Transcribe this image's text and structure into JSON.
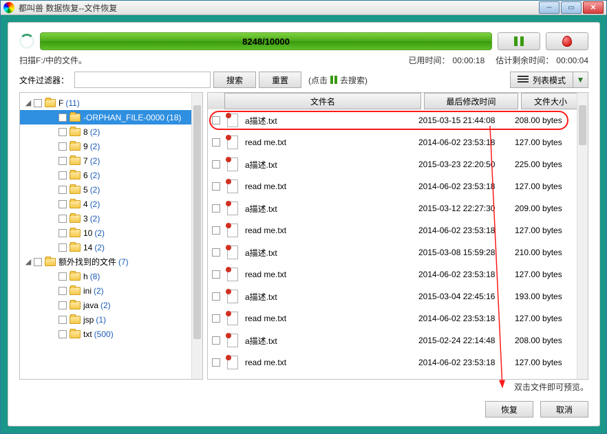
{
  "window": {
    "title": "都叫兽 数据恢复--文件恢复"
  },
  "progress": {
    "text": "8248/10000"
  },
  "status": {
    "scanning": "扫描F:/中的文件。",
    "elapsed_label": "已用时间：",
    "elapsed_value": "00:00:18",
    "remaining_label": "估计剩余时间：",
    "remaining_value": "00:00:04"
  },
  "filter": {
    "label": "文件过滤器：",
    "placeholder": "",
    "search_btn": "搜索",
    "reset_btn": "重置",
    "hint_prefix": "(点击",
    "hint_suffix": "去搜索)",
    "viewmode": "列表模式"
  },
  "list_headers": {
    "name": "文件名",
    "date": "最后修改时间",
    "size": "文件大小"
  },
  "tree": [
    {
      "indent": 0,
      "twisty": "◢",
      "label": "F",
      "count": "(11)",
      "selected": false
    },
    {
      "indent": 1,
      "twisty": "",
      "label": "-ORPHAN_FILE-0000",
      "count": "(18)",
      "selected": true
    },
    {
      "indent": 1,
      "twisty": "",
      "label": "8",
      "count": "(2)"
    },
    {
      "indent": 1,
      "twisty": "",
      "label": "9",
      "count": "(2)"
    },
    {
      "indent": 1,
      "twisty": "",
      "label": "7",
      "count": "(2)"
    },
    {
      "indent": 1,
      "twisty": "",
      "label": "6",
      "count": "(2)"
    },
    {
      "indent": 1,
      "twisty": "",
      "label": "5",
      "count": "(2)"
    },
    {
      "indent": 1,
      "twisty": "",
      "label": "4",
      "count": "(2)"
    },
    {
      "indent": 1,
      "twisty": "",
      "label": "3",
      "count": "(2)"
    },
    {
      "indent": 1,
      "twisty": "",
      "label": "10",
      "count": "(2)"
    },
    {
      "indent": 1,
      "twisty": "",
      "label": "14",
      "count": "(2)"
    },
    {
      "indent": 0,
      "twisty": "◢",
      "label": "额外找到的文件",
      "count": "(7)"
    },
    {
      "indent": 1,
      "twisty": "",
      "label": "h",
      "count": "(8)"
    },
    {
      "indent": 1,
      "twisty": "",
      "label": "ini",
      "count": "(2)"
    },
    {
      "indent": 1,
      "twisty": "",
      "label": "java",
      "count": "(2)"
    },
    {
      "indent": 1,
      "twisty": "",
      "label": "jsp",
      "count": "(1)"
    },
    {
      "indent": 1,
      "twisty": "",
      "label": "txt",
      "count": "(500)"
    }
  ],
  "files": [
    {
      "name": "a描述.txt",
      "date": "2015-03-15 21:44:08",
      "size": "208.00 bytes",
      "highlight": true
    },
    {
      "name": "read me.txt",
      "date": "2014-06-02 23:53:18",
      "size": "127.00 bytes"
    },
    {
      "name": "a描述.txt",
      "date": "2015-03-23 22:20:50",
      "size": "225.00 bytes"
    },
    {
      "name": "read me.txt",
      "date": "2014-06-02 23:53:18",
      "size": "127.00 bytes"
    },
    {
      "name": "a描述.txt",
      "date": "2015-03-12 22:27:30",
      "size": "209.00 bytes"
    },
    {
      "name": "read me.txt",
      "date": "2014-06-02 23:53:18",
      "size": "127.00 bytes"
    },
    {
      "name": "a描述.txt",
      "date": "2015-03-08 15:59:28",
      "size": "210.00 bytes"
    },
    {
      "name": "read me.txt",
      "date": "2014-06-02 23:53:18",
      "size": "127.00 bytes"
    },
    {
      "name": "a描述.txt",
      "date": "2015-03-04 22:45:16",
      "size": "193.00 bytes"
    },
    {
      "name": "read me.txt",
      "date": "2014-06-02 23:53:18",
      "size": "127.00 bytes"
    },
    {
      "name": "a描述.txt",
      "date": "2015-02-24 22:14:48",
      "size": "208.00 bytes"
    },
    {
      "name": "read me.txt",
      "date": "2014-06-02 23:53:18",
      "size": "127.00 bytes"
    }
  ],
  "preview_hint": "双击文件即可预览。",
  "footer": {
    "recover": "恢复",
    "cancel": "取消"
  }
}
